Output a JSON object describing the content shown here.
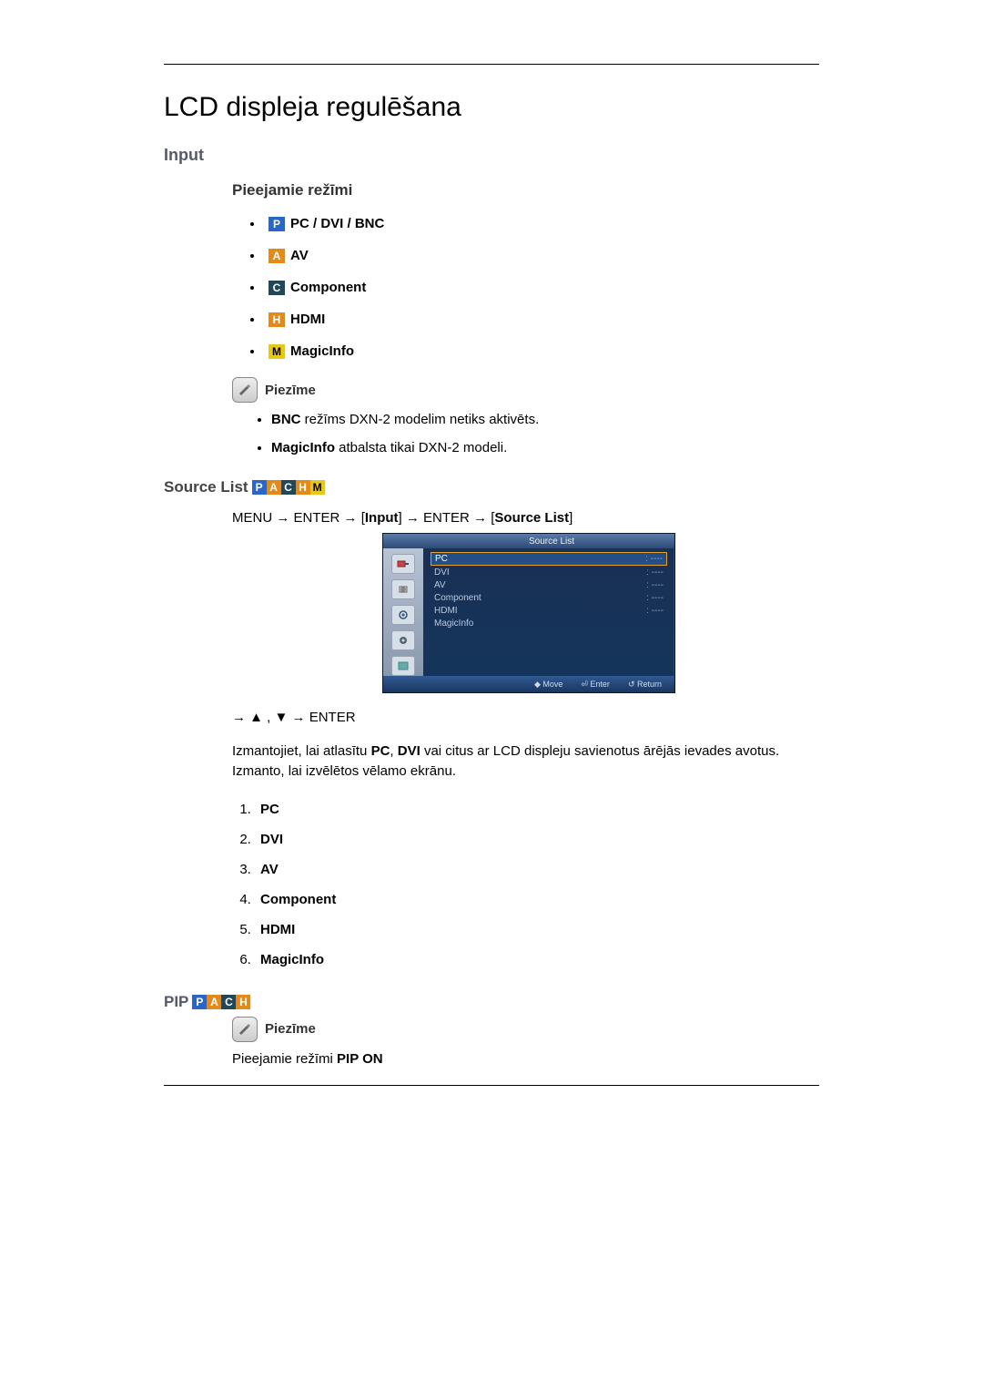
{
  "title": "LCD displeja regulēšana",
  "input_heading": "Input",
  "modes_heading": "Pieejamie režīmi",
  "badges": {
    "P": "P",
    "A": "A",
    "C": "C",
    "H": "H",
    "M": "M"
  },
  "modes": {
    "pc": "PC / DVI / BNC",
    "av": "AV",
    "component": "Component",
    "hdmi": "HDMI",
    "magicinfo": "MagicInfo"
  },
  "note_label": "Piezīme",
  "notes": {
    "n1_bold": "BNC",
    "n1_rest": " režīms DXN-2 modelim netiks aktivēts.",
    "n2_bold": "MagicInfo",
    "n2_rest": " atbalsta tikai DXN-2 modeli."
  },
  "source_list_heading": "Source List",
  "nav": {
    "menu": "MENU",
    "enter": "ENTER",
    "input": "Input",
    "src": "Source List",
    "arrow": "→"
  },
  "osd": {
    "title": "Source List",
    "items": [
      {
        "l": "PC",
        "r": "----"
      },
      {
        "l": "DVI",
        "r": "----"
      },
      {
        "l": "AV",
        "r": "----"
      },
      {
        "l": "Component",
        "r": "----"
      },
      {
        "l": "HDMI",
        "r": "----"
      },
      {
        "l": "MagicInfo",
        "r": ""
      }
    ],
    "footer": {
      "move": "Move",
      "enter": "Enter",
      "return": "Return"
    }
  },
  "arrows_line": "→ ▲ , ▼ → ENTER",
  "body_paragraph": "Izmantojiet, lai atlasītu PC, DVI vai citus ar LCD displeju savienotus ārējās ievades avotus. Izmanto, lai izvēlētos vēlamo ekrānu.",
  "numbered": [
    "PC",
    "DVI",
    "AV",
    "Component",
    "HDMI",
    "MagicInfo"
  ],
  "pip_heading": "PIP",
  "pip_line_prefix": "Pieejamie režīmi ",
  "pip_line_bold": "PIP ON"
}
